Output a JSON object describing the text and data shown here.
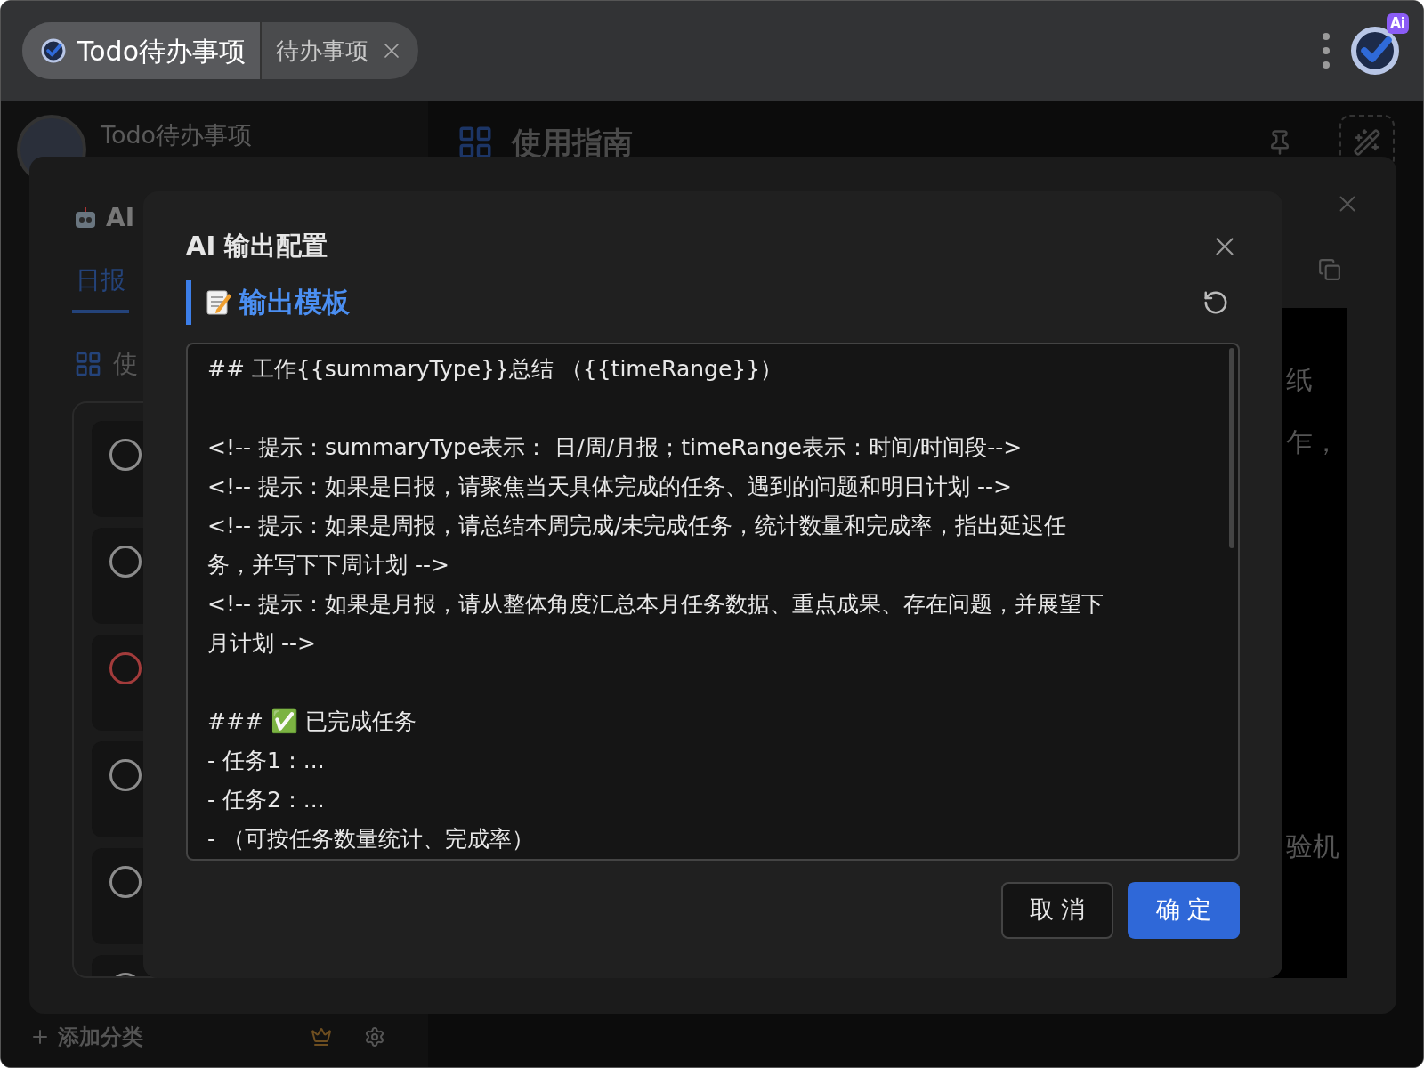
{
  "title_bar": {
    "tabs": [
      {
        "label": "Todo待办事项",
        "selected": true
      },
      {
        "label": "待办事项",
        "selected": false
      }
    ],
    "logo_badge": "Ai"
  },
  "sidebar": {
    "app_name": "Todo待办事项",
    "add_category": "添加分类"
  },
  "main_header": {
    "title": "使用指南"
  },
  "background_fragments": [
    "纸",
    "乍，",
    "验机"
  ],
  "summary_dialog": {
    "title": "AI",
    "tabs": [
      {
        "label": "日报",
        "selected": true
      }
    ],
    "section_label": "使",
    "task_items": [
      {
        "color": "#8c8c8c"
      },
      {
        "color": "#8c8c8c"
      },
      {
        "color": "#a23b3b"
      },
      {
        "color": "#8c8c8c"
      },
      {
        "color": "#8c8c8c"
      },
      {
        "color": "#8c8c8c"
      }
    ]
  },
  "config_dialog": {
    "title": "AI 输出配置",
    "section_label": "输出模板",
    "template": "## 工作{{summaryType}}总结 （{{timeRange}}）\n\n<!-- 提示：summaryType表示： 日/周/月报；timeRange表示：时间/时间段-->\n<!-- 提示：如果是日报，请聚焦当天具体完成的任务、遇到的问题和明日计划 -->\n<!-- 提示：如果是周报，请总结本周完成/未完成任务，统计数量和完成率，指出延迟任务，并写下下周计划 -->\n<!-- 提示：如果是月报，请从整体角度汇总本月任务数据、重点成果、存在问题，并展望下月计划 -->\n\n### ✅ 已完成任务\n- 任务1：...\n- 任务2：...\n- （可按任务数量统计、完成率）",
    "buttons": [
      {
        "label": "取 消",
        "kind": "secondary"
      },
      {
        "label": "确 定",
        "kind": "primary"
      }
    ]
  }
}
